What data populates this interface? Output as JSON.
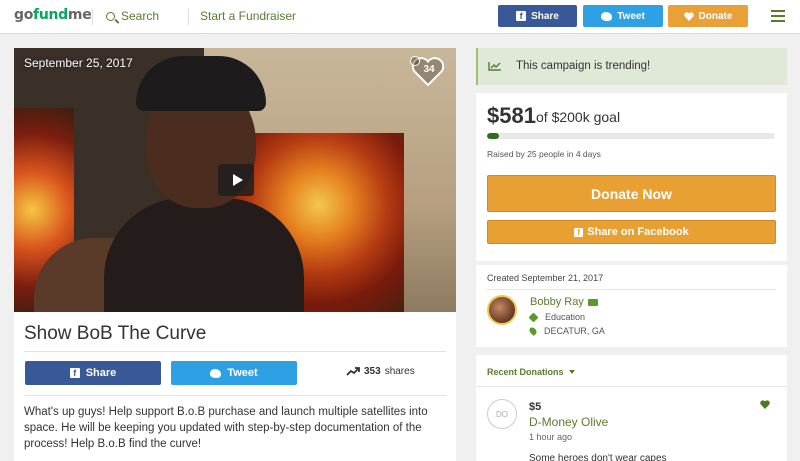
{
  "nav": {
    "logo_prefix": "go",
    "logo_accent": "fund",
    "logo_suffix": "me",
    "search_label": "Search",
    "start_label": "Start a Fundraiser",
    "share_label": "Share",
    "tweet_label": "Tweet",
    "donate_label": "Donate"
  },
  "video": {
    "date": "September 25, 2017",
    "likes": "34"
  },
  "campaign": {
    "title": "Show BoB The Curve",
    "share_label": "Share",
    "tweet_label": "Tweet",
    "shares_count": "353",
    "shares_label": "shares",
    "description": "What's up guys! Help support B.o.B purchase and launch multiple satellites into space. He will be keeping you updated with step-by-step documentation of the process! Help B.o.B find the curve!"
  },
  "sidebar": {
    "trending": "This campaign is trending!",
    "amount": "$581",
    "goal": "of $200k goal",
    "progress": 0.0029,
    "raised": "Raised by 25 people in 4 days",
    "donate_now": "Donate Now",
    "share_facebook": "Share on Facebook",
    "created": "Created September 21, 2017",
    "organizer_name": "Bobby Ray",
    "category": "Education",
    "location": "DECATUR, GA",
    "recent_donations": "Recent Donations",
    "donation": {
      "initials": "DO",
      "amount": "$5",
      "name": "D-Money Olive",
      "time": "1 hour ago",
      "message": "Some heroes don't wear capes"
    }
  },
  "colors": {
    "brand_green": "#02a95c",
    "link_green": "#5a7b2d",
    "facebook": "#385898",
    "twitter": "#2ea0e4",
    "donate_orange": "#e7a031"
  }
}
